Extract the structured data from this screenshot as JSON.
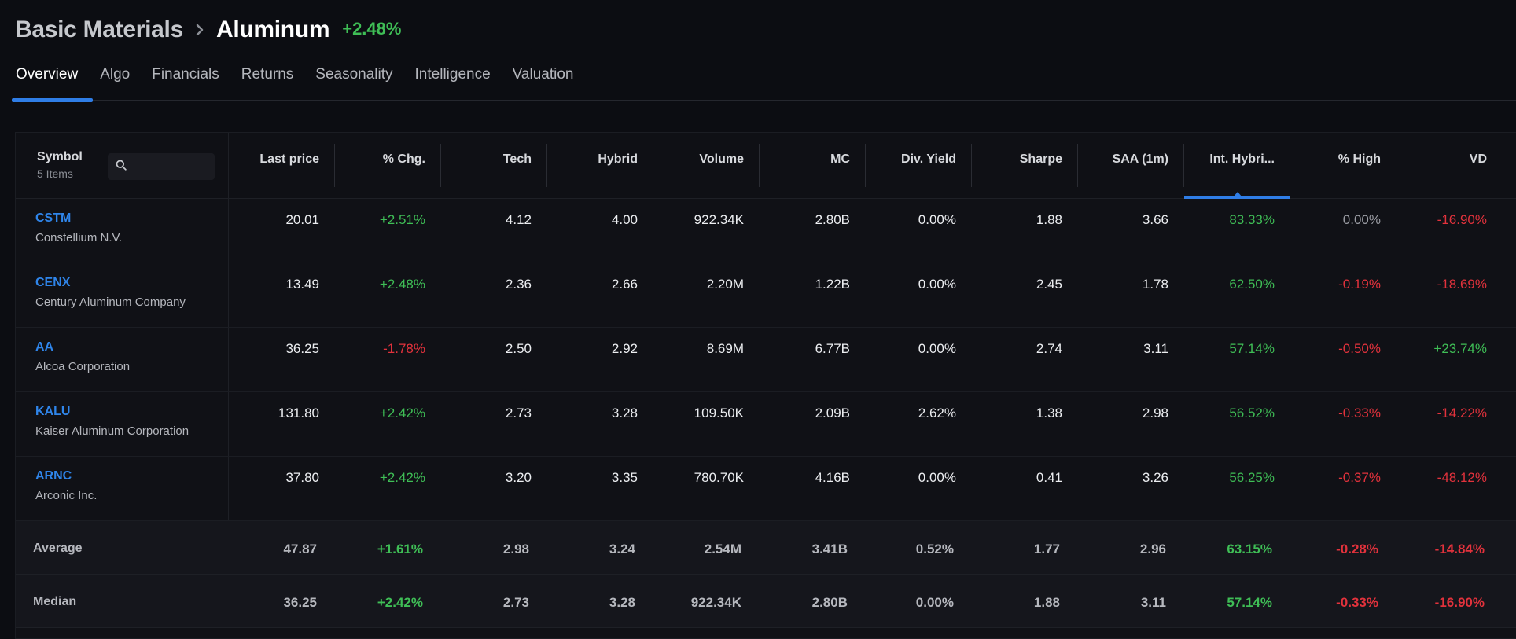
{
  "header": {
    "parent": "Basic Materials",
    "current": "Aluminum",
    "change": "+2.48%"
  },
  "tabs": [
    {
      "label": "Overview",
      "active": true
    },
    {
      "label": "Algo"
    },
    {
      "label": "Financials"
    },
    {
      "label": "Returns"
    },
    {
      "label": "Seasonality"
    },
    {
      "label": "Intelligence"
    },
    {
      "label": "Valuation"
    }
  ],
  "table": {
    "symbol_header": "Symbol",
    "item_count": "5 Items",
    "search_placeholder": "",
    "columns": [
      "Last price",
      "% Chg.",
      "Tech",
      "Hybrid",
      "Volume",
      "MC",
      "Div. Yield",
      "Sharpe",
      "SAA (1m)",
      "Int. Hybri...",
      "% High",
      "VD"
    ],
    "sorted_column": 9,
    "rows": [
      {
        "ticker": "CSTM",
        "name": "Constellium N.V.",
        "cells": [
          "20.01",
          "+2.51%",
          "4.12",
          "4.00",
          "922.34K",
          "2.80B",
          "0.00%",
          "1.88",
          "3.66",
          "83.33%",
          "0.00%",
          "-16.90%"
        ],
        "tones": [
          "",
          "pos",
          "",
          "",
          "",
          "",
          "",
          "",
          "",
          "pos",
          "muted",
          "neg"
        ]
      },
      {
        "ticker": "CENX",
        "name": "Century Aluminum Company",
        "cells": [
          "13.49",
          "+2.48%",
          "2.36",
          "2.66",
          "2.20M",
          "1.22B",
          "0.00%",
          "2.45",
          "1.78",
          "62.50%",
          "-0.19%",
          "-18.69%"
        ],
        "tones": [
          "",
          "pos",
          "",
          "",
          "",
          "",
          "",
          "",
          "",
          "pos",
          "neg",
          "neg"
        ]
      },
      {
        "ticker": "AA",
        "name": "Alcoa Corporation",
        "cells": [
          "36.25",
          "-1.78%",
          "2.50",
          "2.92",
          "8.69M",
          "6.77B",
          "0.00%",
          "2.74",
          "3.11",
          "57.14%",
          "-0.50%",
          "+23.74%"
        ],
        "tones": [
          "",
          "neg",
          "",
          "",
          "",
          "",
          "",
          "",
          "",
          "pos",
          "neg",
          "pos"
        ]
      },
      {
        "ticker": "KALU",
        "name": "Kaiser Aluminum Corporation",
        "cells": [
          "131.80",
          "+2.42%",
          "2.73",
          "3.28",
          "109.50K",
          "2.09B",
          "2.62%",
          "1.38",
          "2.98",
          "56.52%",
          "-0.33%",
          "-14.22%"
        ],
        "tones": [
          "",
          "pos",
          "",
          "",
          "",
          "",
          "",
          "",
          "",
          "pos",
          "neg",
          "neg"
        ]
      },
      {
        "ticker": "ARNC",
        "name": "Arconic Inc.",
        "cells": [
          "37.80",
          "+2.42%",
          "3.20",
          "3.35",
          "780.70K",
          "4.16B",
          "0.00%",
          "0.41",
          "3.26",
          "56.25%",
          "-0.37%",
          "-48.12%"
        ],
        "tones": [
          "",
          "pos",
          "",
          "",
          "",
          "",
          "",
          "",
          "",
          "pos",
          "neg",
          "neg"
        ]
      }
    ],
    "summary": [
      {
        "label": "Average",
        "cells": [
          "47.87",
          "+1.61%",
          "2.98",
          "3.24",
          "2.54M",
          "3.41B",
          "0.52%",
          "1.77",
          "2.96",
          "63.15%",
          "-0.28%",
          "-14.84%"
        ],
        "tones": [
          "",
          "pos",
          "",
          "",
          "",
          "",
          "",
          "",
          "",
          "pos",
          "neg",
          "neg"
        ]
      },
      {
        "label": "Median",
        "cells": [
          "36.25",
          "+2.42%",
          "2.73",
          "3.28",
          "922.34K",
          "2.80B",
          "0.00%",
          "1.88",
          "3.11",
          "57.14%",
          "-0.33%",
          "-16.90%"
        ],
        "tones": [
          "",
          "pos",
          "",
          "",
          "",
          "",
          "",
          "",
          "",
          "pos",
          "neg",
          "neg"
        ]
      }
    ]
  },
  "colors": {
    "accent": "#2f7de6",
    "positive": "#3fbe56",
    "negative": "#e2323c",
    "link": "#2f85ea"
  },
  "icons": {
    "breadcrumb_separator": "chevron-right-icon",
    "search": "search-icon"
  }
}
